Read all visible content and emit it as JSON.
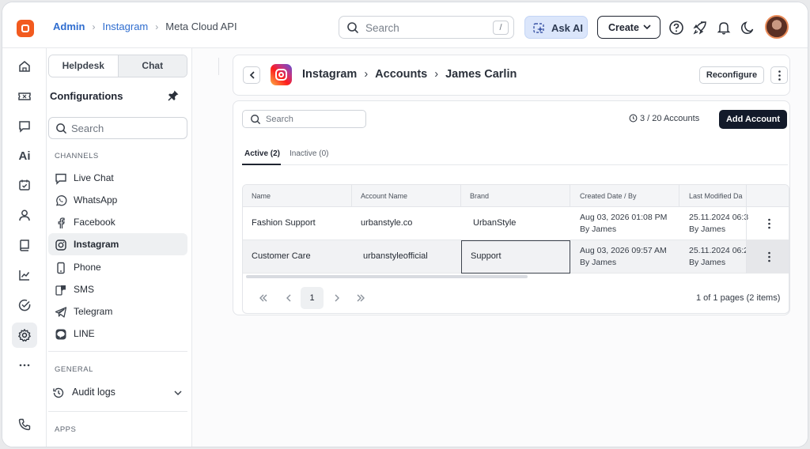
{
  "topbar": {
    "breadcrumb": [
      "Admin",
      "Instagram",
      "Meta Cloud API"
    ],
    "search_placeholder": "Search",
    "search_shortcut": "/",
    "ask_ai_label": "Ask AI",
    "create_label": "Create"
  },
  "sidebar": {
    "segments": [
      "Helpdesk",
      "Chat"
    ],
    "title": "Configurations",
    "search_placeholder": "Search",
    "channels_heading": "CHANNELS",
    "channels": [
      "Live Chat",
      "WhatsApp",
      "Facebook",
      "Instagram",
      "Phone",
      "SMS",
      "Telegram",
      "LINE"
    ],
    "general_heading": "GENERAL",
    "audit_logs": "Audit logs",
    "apps_heading": "APPS"
  },
  "header": {
    "breadcrumb": [
      "Instagram",
      "Accounts",
      "James Carlin"
    ],
    "reconfigure_label": "Reconfigure"
  },
  "accounts": {
    "search_placeholder": "Search",
    "count_label": "3 / 20 Accounts",
    "add_label": "Add Account",
    "tabs": [
      "Active (2)",
      "Inactive (0)"
    ],
    "columns": [
      "Name",
      "Account Name",
      "Brand",
      "Created  Date / By",
      "Last Modified Da"
    ],
    "rows": [
      {
        "name": "Fashion Support",
        "account": "urbanstyle.co",
        "brand": "UrbanStyle",
        "created": "Aug 03, 2026 01:08 PM",
        "created_by": "By James",
        "modified": "25.11.2024 06:3",
        "modified_by": "By James"
      },
      {
        "name": "Customer Care",
        "account": "urbanstyleofficial",
        "brand": "Support",
        "created": "Aug 03, 2026 09:57 AM",
        "created_by": "By James",
        "modified": "25.11.2024 06:2",
        "modified_by": "By James"
      }
    ],
    "pager": {
      "current": "1",
      "info": "1 of 1 pages (2 items)"
    }
  },
  "colors": {
    "accent": "#f25a1f",
    "link": "#2f6dcf",
    "primary_button": "#131a2a"
  }
}
